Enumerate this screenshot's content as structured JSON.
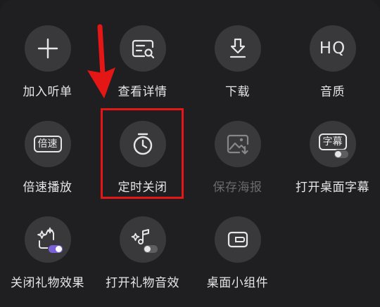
{
  "menu": {
    "items": [
      {
        "label": "加入听单",
        "icon": "plus-icon",
        "enabled": true
      },
      {
        "label": "查看详情",
        "icon": "detail-search-icon",
        "enabled": true
      },
      {
        "label": "下载",
        "icon": "download-icon",
        "enabled": true
      },
      {
        "label": "音质",
        "icon": "hq-icon",
        "hq_text": "HQ",
        "enabled": true
      },
      {
        "label": "倍速播放",
        "icon": "speed-icon",
        "badge_text": "倍速",
        "enabled": true
      },
      {
        "label": "定时关闭",
        "icon": "timer-icon",
        "enabled": true
      },
      {
        "label": "保存海报",
        "icon": "poster-icon",
        "enabled": false
      },
      {
        "label": "打开桌面字幕",
        "icon": "subtitle-toggle-icon",
        "badge_text": "字幕",
        "enabled": true
      },
      {
        "label": "关闭礼物效果",
        "icon": "gift-effect-toggle-icon",
        "enabled": true,
        "toggle_on": true
      },
      {
        "label": "打开礼物音效",
        "icon": "gift-sound-toggle-icon",
        "enabled": true,
        "toggle_on": false
      },
      {
        "label": "桌面小组件",
        "icon": "widget-icon",
        "enabled": true
      }
    ]
  },
  "colors": {
    "panel_bg": "#1f1f21",
    "circle_bg": "#39393b",
    "icon": "#e6e6e6",
    "disabled_text": "#6a6a6c",
    "highlight": "#e51616",
    "toggle_on": "#7b61d9"
  }
}
